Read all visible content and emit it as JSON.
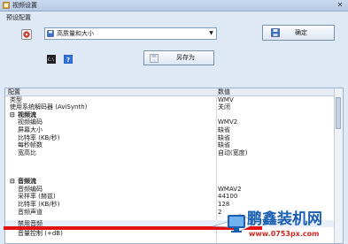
{
  "window": {
    "title": "视频设置",
    "close_glyph": "✕"
  },
  "preset": {
    "section_label": "预设配置",
    "selected": "高质量和大小",
    "confirm_label": "确定",
    "save_as_label": "另存为"
  },
  "grid": {
    "headers": [
      "配置",
      "数值"
    ],
    "rows": [
      {
        "name": "类型",
        "value": "WMV",
        "kind": "item"
      },
      {
        "name": "使用系统解码器 (AviSynth)",
        "value": "关闭",
        "kind": "item"
      },
      {
        "name": "视频流",
        "value": "",
        "kind": "category"
      },
      {
        "name": "视频编码",
        "value": "WMV2",
        "kind": "item"
      },
      {
        "name": "屏幕大小",
        "value": "缺省",
        "kind": "item"
      },
      {
        "name": "比特率 (KB/秒)",
        "value": "缺省",
        "kind": "item"
      },
      {
        "name": "每秒帧数",
        "value": "缺省",
        "kind": "item"
      },
      {
        "name": "宽高比",
        "value": "自动(宽度)",
        "kind": "item"
      },
      {
        "name": "",
        "value": "",
        "kind": "blank"
      },
      {
        "name": "音频流",
        "value": "",
        "kind": "category"
      },
      {
        "name": "音频编码",
        "value": "WMAV2",
        "kind": "item"
      },
      {
        "name": "采样率 (赫兹)",
        "value": "44100",
        "kind": "item"
      },
      {
        "name": "比特率 (KB/秒)",
        "value": "128",
        "kind": "item"
      },
      {
        "name": "音频声道",
        "value": "2",
        "kind": "item"
      },
      {
        "name": "禁用音频",
        "value": "",
        "kind": "item"
      },
      {
        "name": "音量控制 (+dB)",
        "value": "",
        "kind": "item"
      }
    ]
  },
  "watermark": {
    "brand": "鹏鑫装机网",
    "url": "www.0753px.com"
  },
  "colors": {
    "highlight": "#e21010",
    "brand_blue": "#1b5fb0",
    "url_red": "#d0281f"
  },
  "icons": {
    "window": "video-settings-icon",
    "preset": "video-file-icon",
    "select": "floppy-icon",
    "confirm": "floppy-icon",
    "save_as": "floppy-icon",
    "dos": "dos-icon",
    "help": "help-icon"
  }
}
